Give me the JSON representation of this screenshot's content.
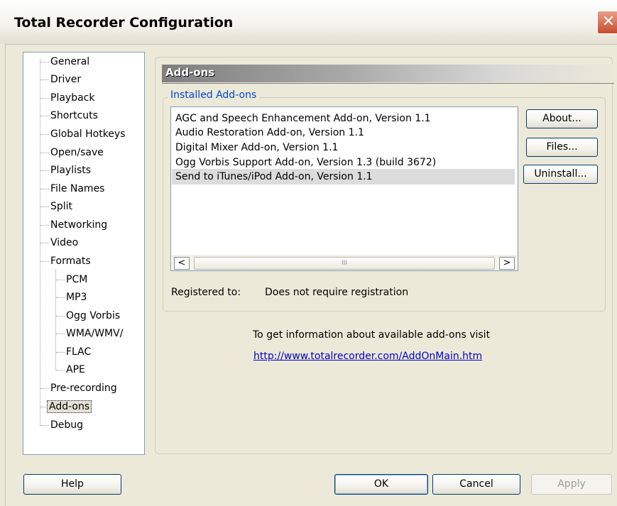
{
  "window": {
    "title": "Total Recorder Configuration",
    "close_glyph": "✕"
  },
  "tree": {
    "items": [
      {
        "label": "General"
      },
      {
        "label": "Driver"
      },
      {
        "label": "Playback"
      },
      {
        "label": "Shortcuts"
      },
      {
        "label": "Global Hotkeys"
      },
      {
        "label": "Open/save"
      },
      {
        "label": "Playlists"
      },
      {
        "label": "File Names"
      },
      {
        "label": "Split"
      },
      {
        "label": "Networking"
      },
      {
        "label": "Video"
      },
      {
        "label": "Formats"
      },
      {
        "label": "PCM"
      },
      {
        "label": "MP3"
      },
      {
        "label": "Ogg Vorbis"
      },
      {
        "label": "WMA/WMV/"
      },
      {
        "label": "FLAC"
      },
      {
        "label": "APE"
      },
      {
        "label": "Pre-recording"
      },
      {
        "label": "Add-ons"
      },
      {
        "label": "Debug"
      }
    ],
    "selected": "Add-ons"
  },
  "panel": {
    "header": "Add-ons",
    "group_title": "Installed Add-ons",
    "addons": [
      "AGC and Speech Enhancement Add-on, Version 1.1",
      "Audio Restoration Add-on, Version 1.1",
      "Digital Mixer Add-on, Version 1.1",
      "Ogg Vorbis Support Add-on, Version 1.3 (build 3672)",
      "Send to iTunes/iPod Add-on, Version 1.1"
    ],
    "selected_addon": "Send to iTunes/iPod Add-on, Version 1.1",
    "scroll_left": "<",
    "scroll_right": ">",
    "scroll_grip": "III",
    "buttons": {
      "about": "About...",
      "files": "Files...",
      "uninstall": "Uninstall..."
    },
    "registered_label": "Registered to:",
    "registered_value": "Does not require registration",
    "info_text": "To get information about available add-ons visit",
    "info_link": "http://www.totalrecorder.com/AddOnMain.htm"
  },
  "footer": {
    "help": "Help",
    "ok": "OK",
    "cancel": "Cancel",
    "apply": "Apply"
  }
}
